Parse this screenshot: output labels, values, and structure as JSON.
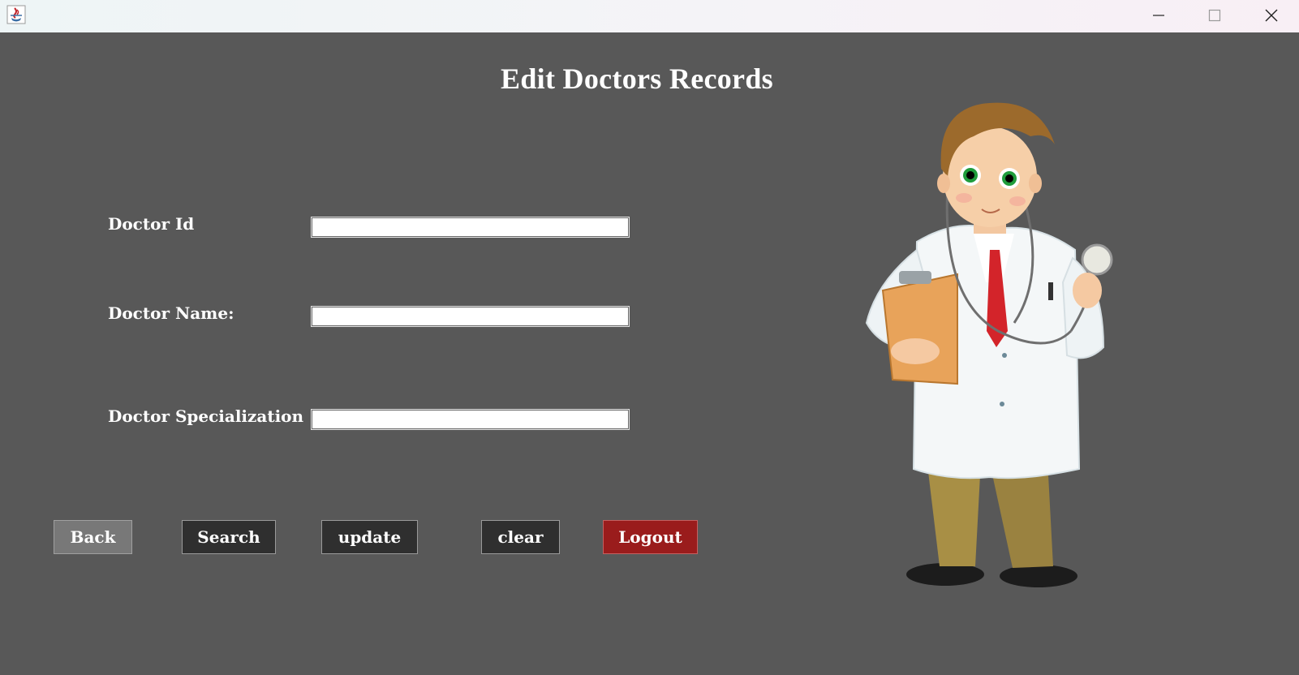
{
  "window": {
    "app_icon": "java-cup-icon",
    "minimize_icon": "minimize-icon",
    "maximize_icon": "maximize-icon",
    "close_icon": "close-icon"
  },
  "page": {
    "title": "Edit Doctors Records"
  },
  "form": {
    "doctor_id_label": "Doctor Id",
    "doctor_id_value": "",
    "doctor_name_label": "Doctor Name:",
    "doctor_name_value": "",
    "doctor_spec_label": "Doctor Specialization",
    "doctor_spec_value": ""
  },
  "buttons": {
    "back": "Back",
    "search": "Search",
    "update": "update",
    "clear": "clear",
    "logout": "Logout"
  },
  "colors": {
    "background": "#585858",
    "button_dark": "#2f2f2f",
    "button_back": "#787878",
    "button_logout": "#9a1c1c"
  },
  "illustration": "doctor-cartoon-with-clipboard-and-stethoscope"
}
